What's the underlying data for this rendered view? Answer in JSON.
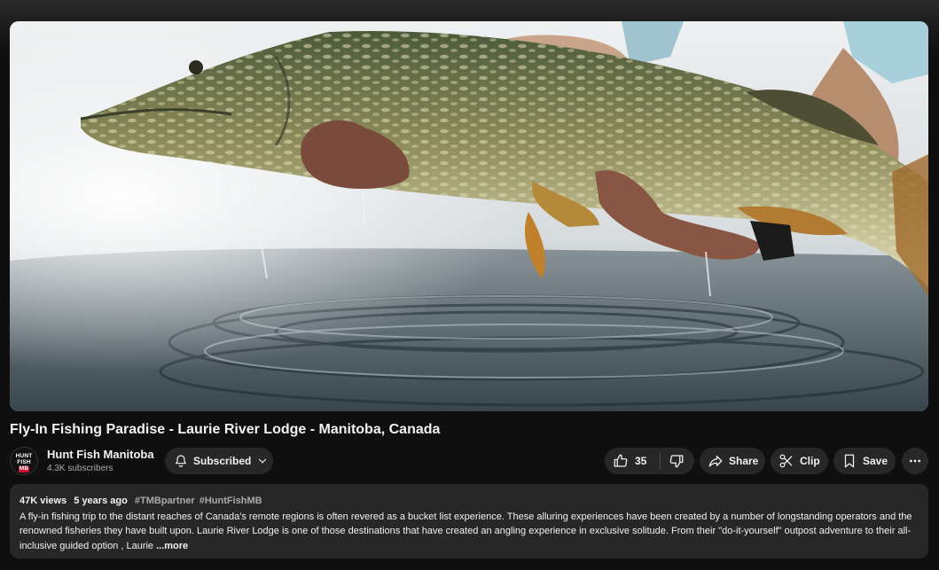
{
  "video": {
    "title": "Fly-In Fishing Paradise - Laurie River Lodge - Manitoba, Canada"
  },
  "channel": {
    "avatar_lines": [
      "HUNT",
      "FISH",
      "MB"
    ],
    "name": "Hunt Fish Manitoba",
    "subscribers": "4.3K subscribers"
  },
  "actions": {
    "subscribed_label": "Subscribed",
    "like_count": "35",
    "share_label": "Share",
    "clip_label": "Clip",
    "save_label": "Save"
  },
  "description": {
    "views": "47K views",
    "age": "5 years ago",
    "hashtags": [
      "#TMBpartner",
      "#HuntFishMB"
    ],
    "text": "A fly-in fishing trip to the distant reaches of Canada's remote regions is often revered as a bucket list experience. These alluring experiences have been created by a number of longstanding operators and the renowned fisheries they have built upon. Laurie River Lodge is one of those destinations that have created an angling experience in exclusive solitude. From their \"do-it-yourself\" outpost adventure to their all-inclusive guided option , Laurie",
    "more_label": "...more"
  },
  "icons": {
    "subscribed": "bell-icon",
    "subscribed_menu": "chevron-down-icon",
    "like": "thumbs-up-icon",
    "dislike": "thumbs-down-icon",
    "share": "share-arrow-icon",
    "clip": "scissors-icon",
    "save": "bookmark-icon",
    "more": "more-horizontal-icon"
  },
  "colors": {
    "background": "#0f0f0f",
    "pill": "#272727",
    "text": "#f1f1f1",
    "secondary_text": "#aaaaaa",
    "brand_red": "#c8102e"
  }
}
